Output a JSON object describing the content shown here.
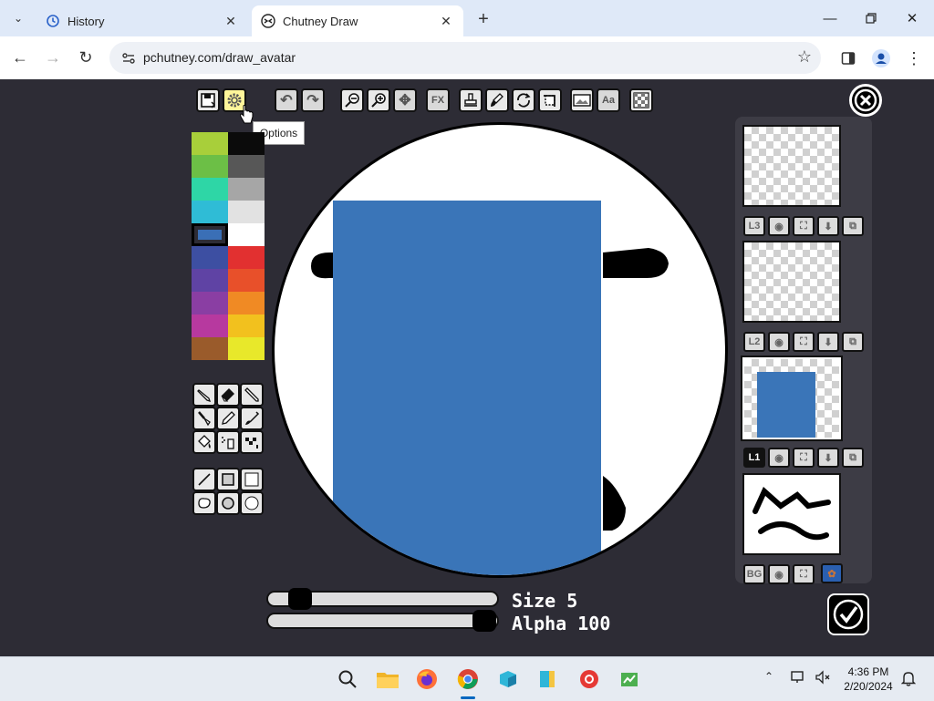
{
  "browser": {
    "tabs": [
      {
        "title": "History",
        "icon": "history-icon"
      },
      {
        "title": "Chutney Draw",
        "icon": "chutney-favicon"
      }
    ],
    "url": "pchutney.com/draw_avatar"
  },
  "tooltip": "Options",
  "toolbar": {
    "fx_label": "FX",
    "text_label": "Aa"
  },
  "palette": {
    "selected": "#3a6fb6",
    "left_colors": [
      "#a8cf3a",
      "#6cbf46",
      "#2ed6a6",
      "#2fbcd6",
      "#3a6fb6",
      "#3d4fa2",
      "#5f43a4",
      "#8a3ea3",
      "#b7399f",
      "#9a5b2b"
    ],
    "right_colors": [
      "#0b0b0b",
      "#575757",
      "#a6a6a6",
      "#e2e2e2",
      "#ffffff",
      "#e23030",
      "#e8502a",
      "#f08a24",
      "#f2c11e",
      "#e8e82a"
    ]
  },
  "layers": [
    {
      "label": "L3"
    },
    {
      "label": "L2"
    },
    {
      "label": "L1"
    },
    {
      "label": "BG"
    }
  ],
  "sliders": {
    "size_label": "Size",
    "size_value": "5",
    "alpha_label": "Alpha",
    "alpha_value": "100",
    "size_level": 0.1,
    "alpha_level": 1.0
  },
  "taskbar": {
    "time": "4:36 PM",
    "date": "2/20/2024"
  }
}
